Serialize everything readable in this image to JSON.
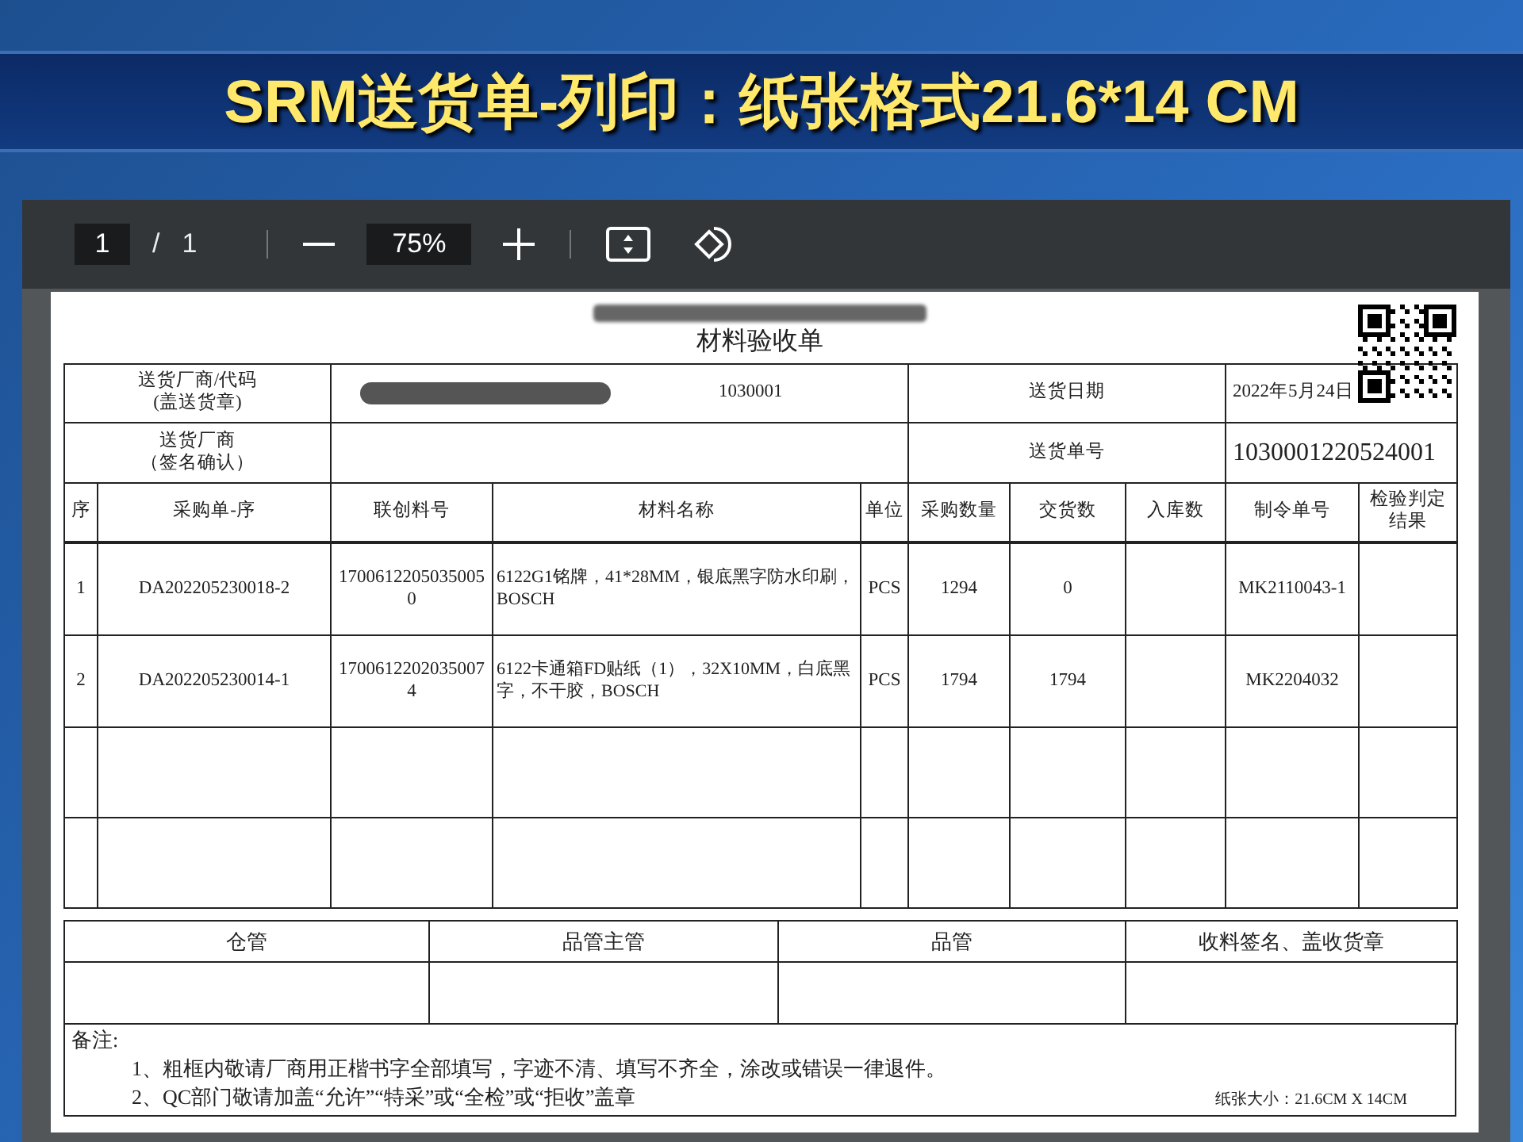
{
  "slide_title": "SRM送货单-列印：纸张格式21.6*14 CM",
  "toolbar": {
    "page": "1",
    "separator": "/",
    "total_pages": "1",
    "zoom": "75%"
  },
  "document": {
    "title": "材料验收单",
    "header": [
      {
        "label": "送货厂商/代码",
        "sublabel": "(盖送货章)",
        "value": "1030001",
        "value_label": "送货日期",
        "value2": "2022年5月24日"
      },
      {
        "label": "送货厂商",
        "sublabel": "（签名确认）",
        "value_label": "送货单号",
        "value2": "1030001220524001"
      }
    ],
    "columns": [
      "序",
      "采购单-序",
      "联创料号",
      "材料名称",
      "单位",
      "采购数量",
      "交货数",
      "入库数",
      "制令单号",
      "检验判定结果"
    ],
    "rows": [
      {
        "seq": "1",
        "po": "DA202205230018-2",
        "part": "17006122050350050",
        "name": "6122G1铭牌，41*28MM，银底黑字防水印刷，BOSCH",
        "unit": "PCS",
        "ordered": "1294",
        "delivered": "0",
        "order_no": "MK2110043-1"
      },
      {
        "seq": "2",
        "po": "DA202205230014-1",
        "part": "17006122020350074",
        "name": "6122卡通箱FD贴纸（1），32X10MM，白底黑字，不干胶，BOSCH",
        "unit": "PCS",
        "ordered": "1794",
        "delivered": "1794",
        "order_no": "MK2204032"
      }
    ],
    "signatures": [
      "仓管",
      "品管主管",
      "品管",
      "收料签名、盖收货章"
    ],
    "notes_label": "备注:",
    "notes": [
      "1、粗框内敬请厂商用正楷书字全部填写，字迹不清、填写不齐全，涂改或错误一律退件。",
      "2、QC部门敬请加盖“允许”“特采”或“全检”或“拒收”盖章"
    ],
    "paper_size": "纸张大小：21.6CM X 14CM"
  }
}
